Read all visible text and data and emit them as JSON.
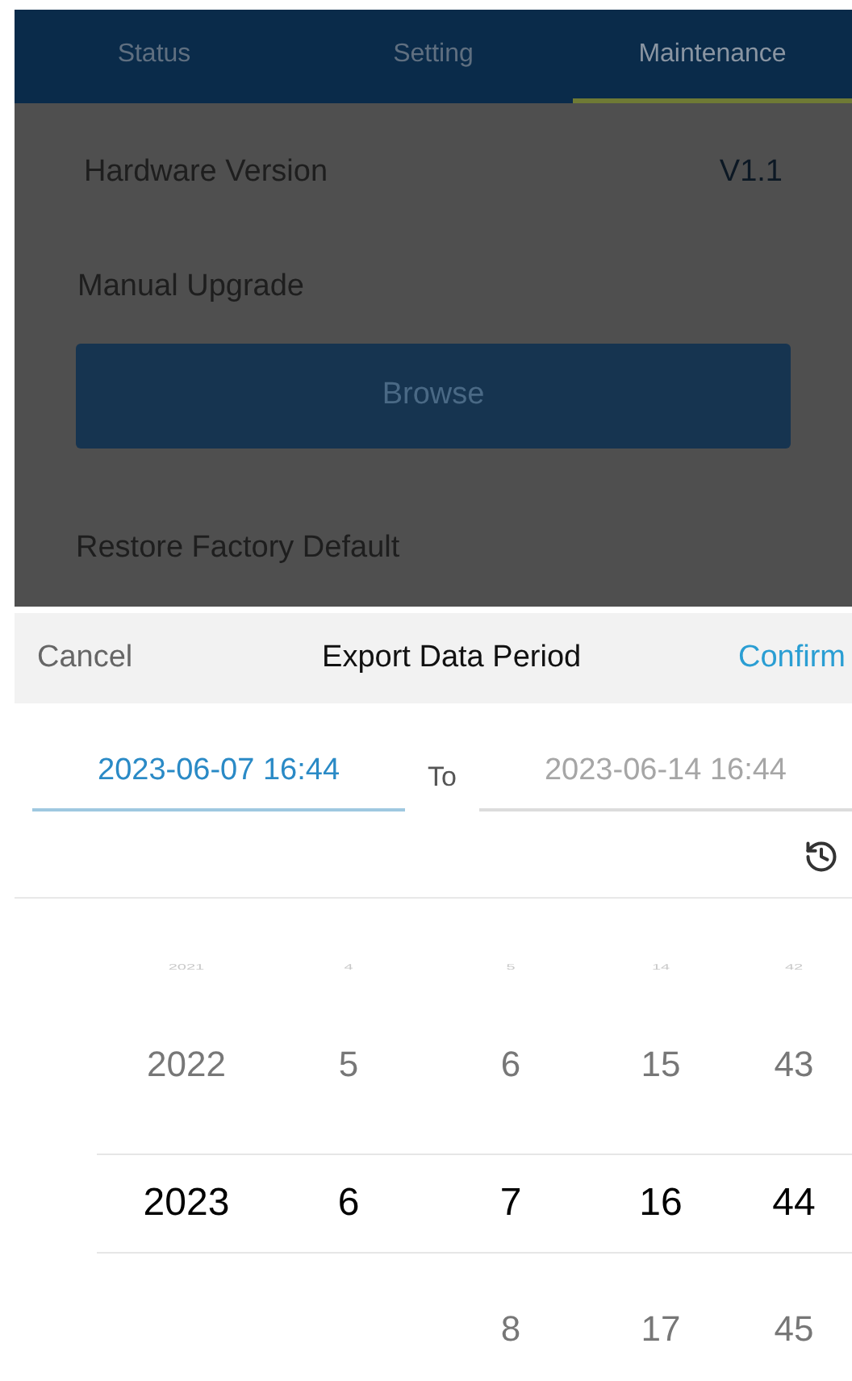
{
  "tabs": [
    {
      "label": "Status",
      "selected": false
    },
    {
      "label": "Setting",
      "selected": false
    },
    {
      "label": "Maintenance",
      "selected": true
    }
  ],
  "hardware_version": {
    "label": "Hardware Version",
    "value": "V1.1"
  },
  "manual_upgrade": {
    "label": "Manual Upgrade",
    "button": "Browse"
  },
  "restore": {
    "label": "Restore Factory Default"
  },
  "dialog": {
    "cancel": "Cancel",
    "title": "Export Data Period",
    "confirm": "Confirm",
    "from": {
      "value": "2023-06-07 16:44",
      "selected": true
    },
    "separator": "To",
    "to": {
      "value": "2023-06-14 16:44",
      "selected": false
    },
    "columns": [
      {
        "items": [
          {
            "text": "2021",
            "selected": false
          },
          {
            "text": "2022",
            "selected": false
          },
          {
            "text": "2023",
            "selected": true
          }
        ]
      },
      {
        "items": [
          {
            "text": "4",
            "selected": false
          },
          {
            "text": "5",
            "selected": false
          },
          {
            "text": "6",
            "selected": true
          }
        ]
      },
      {
        "items": [
          {
            "text": "5",
            "selected": false
          },
          {
            "text": "6",
            "selected": false
          },
          {
            "text": "7",
            "selected": true
          },
          {
            "text": "8",
            "selected": false
          }
        ]
      },
      {
        "items": [
          {
            "text": "14",
            "selected": false
          },
          {
            "text": "15",
            "selected": false
          },
          {
            "text": "16",
            "selected": true
          },
          {
            "text": "17",
            "selected": false
          }
        ]
      },
      {
        "items": [
          {
            "text": "42",
            "selected": false
          },
          {
            "text": "43",
            "selected": false
          },
          {
            "text": "44",
            "selected": true
          },
          {
            "text": "45",
            "selected": false
          }
        ]
      }
    ]
  }
}
